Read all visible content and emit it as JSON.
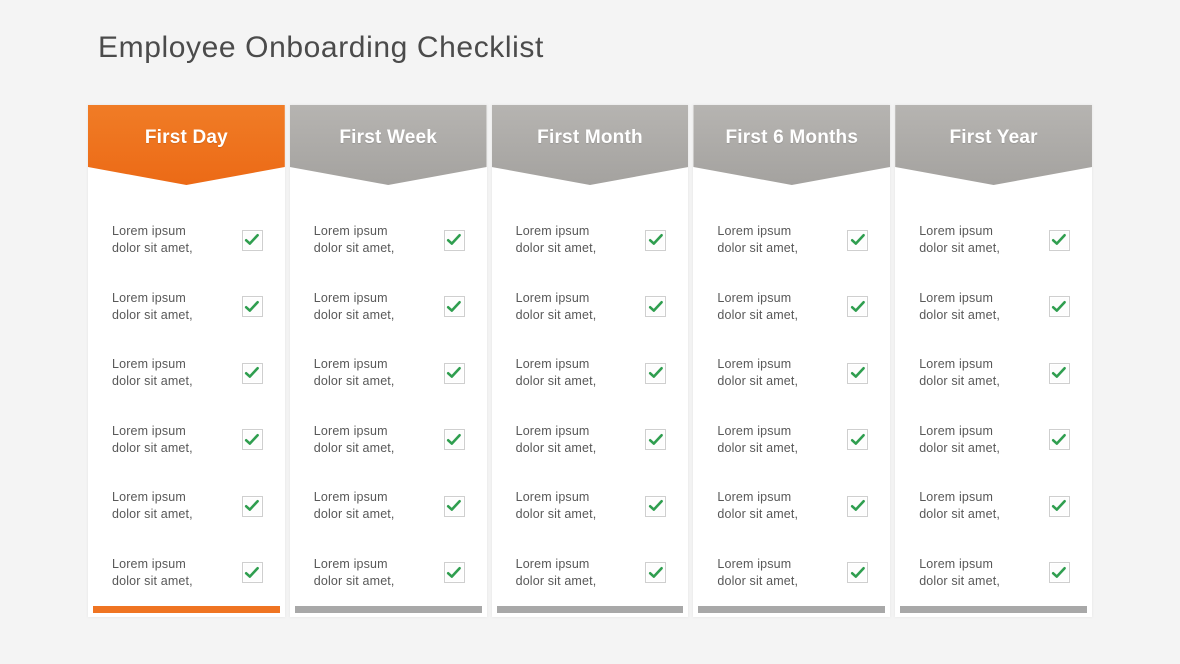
{
  "slide": {
    "title": "Employee Onboarding Checklist",
    "background_color": "#f4f4f4",
    "title_color": "#4b4b4b"
  },
  "theme": {
    "accent_color": "#ec6a16",
    "neutral_color": "#a4a29f",
    "check_color": "#2f9e4f",
    "checkbox_border_color": "#cfcfcf",
    "card_background": "#ffffff",
    "body_text_color": "#585858"
  },
  "columns": [
    {
      "header": "First Day",
      "style": "accent",
      "items": [
        {
          "text": "Lorem ipsum dolor sit amet,",
          "checked": true
        },
        {
          "text": "Lorem ipsum dolor sit amet,",
          "checked": true
        },
        {
          "text": "Lorem ipsum dolor sit amet,",
          "checked": true
        },
        {
          "text": "Lorem ipsum dolor sit amet,",
          "checked": true
        },
        {
          "text": "Lorem ipsum dolor sit amet,",
          "checked": true
        },
        {
          "text": "Lorem ipsum dolor sit amet,",
          "checked": true
        }
      ]
    },
    {
      "header": "First Week",
      "style": "neutral",
      "items": [
        {
          "text": "Lorem ipsum dolor sit amet,",
          "checked": true
        },
        {
          "text": "Lorem ipsum dolor sit amet,",
          "checked": true
        },
        {
          "text": "Lorem ipsum dolor sit amet,",
          "checked": true
        },
        {
          "text": "Lorem ipsum dolor sit amet,",
          "checked": true
        },
        {
          "text": "Lorem ipsum dolor sit amet,",
          "checked": true
        },
        {
          "text": "Lorem ipsum dolor sit amet,",
          "checked": true
        }
      ]
    },
    {
      "header": "First Month",
      "style": "neutral",
      "items": [
        {
          "text": "Lorem ipsum dolor sit amet,",
          "checked": true
        },
        {
          "text": "Lorem ipsum dolor sit amet,",
          "checked": true
        },
        {
          "text": "Lorem ipsum dolor sit amet,",
          "checked": true
        },
        {
          "text": "Lorem ipsum dolor sit amet,",
          "checked": true
        },
        {
          "text": "Lorem ipsum dolor sit amet,",
          "checked": true
        },
        {
          "text": "Lorem ipsum dolor sit amet,",
          "checked": true
        }
      ]
    },
    {
      "header": "First 6 Months",
      "style": "neutral",
      "items": [
        {
          "text": "Lorem ipsum dolor sit amet,",
          "checked": true
        },
        {
          "text": "Lorem ipsum dolor sit amet,",
          "checked": true
        },
        {
          "text": "Lorem ipsum dolor sit amet,",
          "checked": true
        },
        {
          "text": "Lorem ipsum dolor sit amet,",
          "checked": true
        },
        {
          "text": "Lorem ipsum dolor sit amet,",
          "checked": true
        },
        {
          "text": "Lorem ipsum dolor sit amet,",
          "checked": true
        }
      ]
    },
    {
      "header": "First Year",
      "style": "neutral",
      "items": [
        {
          "text": "Lorem ipsum dolor sit amet,",
          "checked": true
        },
        {
          "text": "Lorem ipsum dolor sit amet,",
          "checked": true
        },
        {
          "text": "Lorem ipsum dolor sit amet,",
          "checked": true
        },
        {
          "text": "Lorem ipsum dolor sit amet,",
          "checked": true
        },
        {
          "text": "Lorem ipsum dolor sit amet,",
          "checked": true
        },
        {
          "text": "Lorem ipsum dolor sit amet,",
          "checked": true
        }
      ]
    }
  ],
  "icons": {
    "check": "check-icon"
  }
}
